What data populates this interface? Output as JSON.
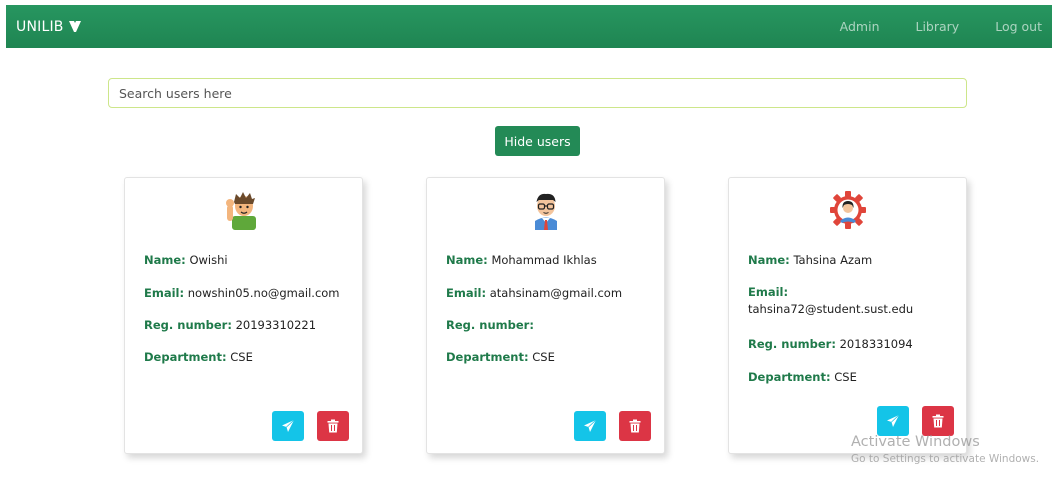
{
  "navbar": {
    "brand": "UNILIB",
    "links": [
      "Admin",
      "Library",
      "Log out"
    ]
  },
  "search": {
    "placeholder": "Search users here",
    "value": ""
  },
  "toggle_button": "Hide users",
  "field_labels": {
    "name": "Name:",
    "email": "Email:",
    "reg": "Reg. number:",
    "dept": "Department:"
  },
  "users": [
    {
      "name": "Owishi",
      "email": "nowshin05.no@gmail.com",
      "reg": "20193310221",
      "dept": "CSE",
      "avatar": "boy-waving-icon"
    },
    {
      "name": "Mohammad Ikhlas",
      "email": "atahsinam@gmail.com",
      "reg": "",
      "dept": "CSE",
      "avatar": "man-glasses-icon"
    },
    {
      "name": "Tahsina Azam",
      "email": "tahsina72@student.sust.edu",
      "reg": "2018331094",
      "dept": "CSE",
      "avatar": "woman-gear-icon"
    }
  ],
  "watermark": {
    "line1": "Activate Windows",
    "line2": "Go to Settings to activate Windows."
  },
  "colors": {
    "brand_green": "#238a56",
    "label_green": "#1f7a4a",
    "send": "#14c4e8",
    "delete": "#dc3545"
  }
}
